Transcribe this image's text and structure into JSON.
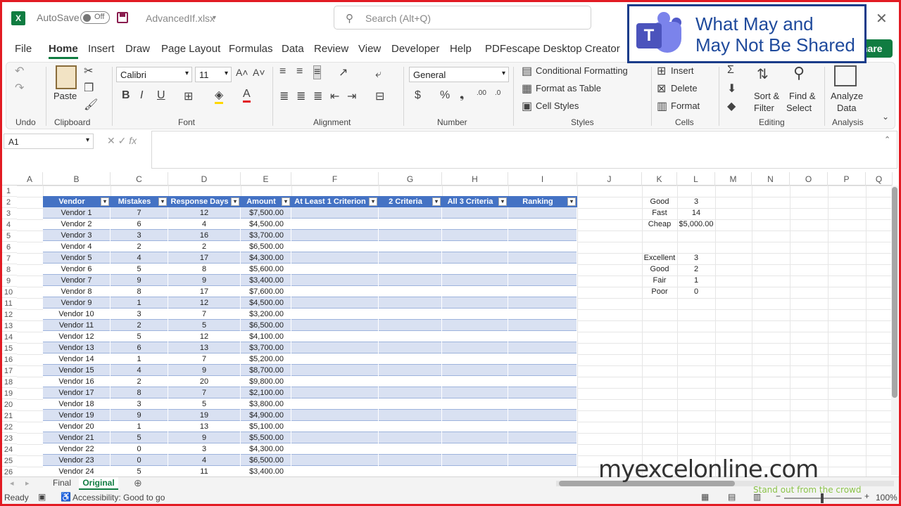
{
  "titlebar": {
    "autosave_label": "AutoSave",
    "autosave_state": "Off",
    "filename": "AdvancedIf.xlsx",
    "search_placeholder": "Search (Alt+Q)"
  },
  "overlay": {
    "line1": "What May and",
    "line2": "May Not Be Shared",
    "share_label": "hare"
  },
  "tabs": [
    "File",
    "Home",
    "Insert",
    "Draw",
    "Page Layout",
    "Formulas",
    "Data",
    "Review",
    "View",
    "Developer",
    "Help",
    "PDFescape Desktop Creator"
  ],
  "ribbon": {
    "undo_group": "Undo",
    "clipboard_group": "Clipboard",
    "paste_label": "Paste",
    "font_group": "Font",
    "font_name": "Calibri",
    "font_size": "11",
    "alignment_group": "Alignment",
    "number_group": "Number",
    "number_format": "General",
    "styles_group": "Styles",
    "conditional_formatting": "Conditional Formatting",
    "format_as_table": "Format as Table",
    "cell_styles": "Cell Styles",
    "cells_group": "Cells",
    "insert": "Insert",
    "delete": "Delete",
    "format": "Format",
    "editing_group": "Editing",
    "sort_filter_1": "Sort &",
    "sort_filter_2": "Filter",
    "find_select_1": "Find &",
    "find_select_2": "Select",
    "analysis_group": "Analysis",
    "analyze_1": "Analyze",
    "analyze_2": "Data"
  },
  "formula_bar": {
    "name_box": "A1",
    "fx": "fx"
  },
  "columns": [
    "A",
    "B",
    "C",
    "D",
    "E",
    "F",
    "G",
    "H",
    "I",
    "J",
    "K",
    "L",
    "M",
    "N",
    "O",
    "P",
    "Q"
  ],
  "table": {
    "headers": [
      "Vendor",
      "Mistakes",
      "Response Days",
      "Amount",
      "At Least 1 Criterion",
      "2 Criteria",
      "All 3 Criteria",
      "Ranking"
    ],
    "rows": [
      [
        "Vendor 1",
        "7",
        "12",
        "$7,500.00"
      ],
      [
        "Vendor 2",
        "6",
        "4",
        "$4,500.00"
      ],
      [
        "Vendor 3",
        "3",
        "16",
        "$3,700.00"
      ],
      [
        "Vendor 4",
        "2",
        "2",
        "$6,500.00"
      ],
      [
        "Vendor 5",
        "4",
        "17",
        "$4,300.00"
      ],
      [
        "Vendor 6",
        "5",
        "8",
        "$5,600.00"
      ],
      [
        "Vendor 7",
        "9",
        "9",
        "$3,400.00"
      ],
      [
        "Vendor 8",
        "8",
        "17",
        "$7,600.00"
      ],
      [
        "Vendor 9",
        "1",
        "12",
        "$4,500.00"
      ],
      [
        "Vendor 10",
        "3",
        "7",
        "$3,200.00"
      ],
      [
        "Vendor 11",
        "2",
        "5",
        "$6,500.00"
      ],
      [
        "Vendor 12",
        "5",
        "12",
        "$4,100.00"
      ],
      [
        "Vendor 13",
        "6",
        "13",
        "$3,700.00"
      ],
      [
        "Vendor 14",
        "1",
        "7",
        "$5,200.00"
      ],
      [
        "Vendor 15",
        "4",
        "9",
        "$8,700.00"
      ],
      [
        "Vendor 16",
        "2",
        "20",
        "$9,800.00"
      ],
      [
        "Vendor 17",
        "8",
        "7",
        "$2,100.00"
      ],
      [
        "Vendor 18",
        "3",
        "5",
        "$3,800.00"
      ],
      [
        "Vendor 19",
        "9",
        "19",
        "$4,900.00"
      ],
      [
        "Vendor 20",
        "1",
        "13",
        "$5,100.00"
      ],
      [
        "Vendor 21",
        "5",
        "9",
        "$5,500.00"
      ],
      [
        "Vendor 22",
        "0",
        "3",
        "$4,300.00"
      ],
      [
        "Vendor 23",
        "0",
        "4",
        "$6,500.00"
      ],
      [
        "Vendor 24",
        "5",
        "11",
        "$3,400.00"
      ]
    ]
  },
  "criteria": [
    [
      "Good",
      "3"
    ],
    [
      "Fast",
      "14"
    ],
    [
      "Cheap",
      "$5,000.00"
    ]
  ],
  "rankings": [
    [
      "Excellent",
      "3"
    ],
    [
      "Good",
      "2"
    ],
    [
      "Fair",
      "1"
    ],
    [
      "Poor",
      "0"
    ]
  ],
  "sheets": [
    "Final",
    "Original"
  ],
  "status": {
    "ready": "Ready",
    "accessibility": "Accessibility: Good to go",
    "zoom": "100%"
  },
  "brand": {
    "name": "myexcelonline.com",
    "tagline": "Stand out from the crowd"
  }
}
